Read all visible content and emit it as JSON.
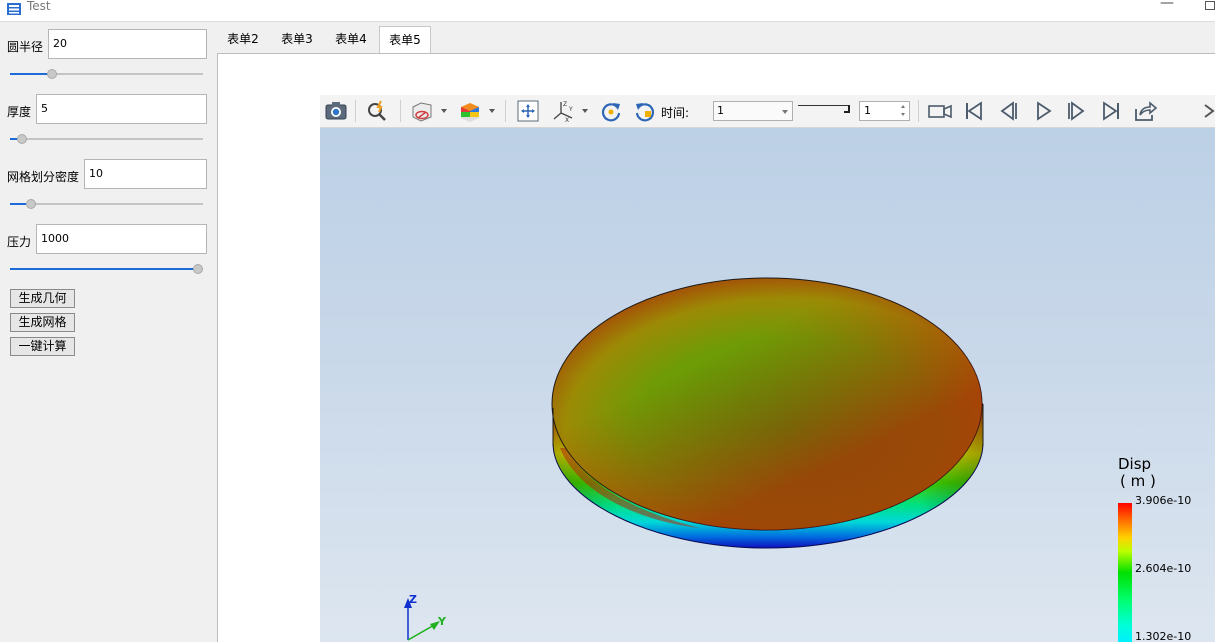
{
  "window": {
    "title": "Test",
    "minimize_glyph": "—"
  },
  "params": {
    "radius": {
      "label": "圆半径",
      "value": "20",
      "slider_fraction": 0.2
    },
    "thickness": {
      "label": "厚度",
      "value": "5",
      "slider_fraction": 0.04
    },
    "mesh_density": {
      "label": "网格划分密度",
      "value": "10",
      "slider_fraction": 0.09
    },
    "pressure": {
      "label": "压力",
      "value": "1000",
      "slider_fraction": 1.0
    }
  },
  "actions": {
    "gen_geometry": "生成几何",
    "gen_mesh": "生成网格",
    "compute": "一键计算"
  },
  "tabs": [
    {
      "label": "表单2",
      "active": false
    },
    {
      "label": "表单3",
      "active": false
    },
    {
      "label": "表单4",
      "active": false
    },
    {
      "label": "表单5",
      "active": true
    }
  ],
  "viewer": {
    "time_label": "时间:",
    "time_value": "1",
    "time_step": "1",
    "legend": {
      "title": "Disp",
      "unit": "( m )",
      "ticks": [
        "3.906e-10",
        "2.604e-10",
        "1.302e-10"
      ]
    },
    "axes": {
      "z": "Z",
      "y": "Y"
    }
  },
  "icons": {
    "toolbar": [
      "camera-icon",
      "probe-icon",
      "display-mode-icon",
      "color-map-icon",
      "fit-view-icon",
      "axis-view-icon",
      "rotate-cw-icon",
      "rotate-ccw-icon",
      "record-icon",
      "first-frame-icon",
      "previous-frame-icon",
      "play-icon",
      "next-frame-icon",
      "last-frame-icon",
      "export-icon"
    ]
  },
  "colors": {
    "accent": "#1c6bd6",
    "scene_top": "#bcd0e6",
    "scene_bottom": "#dde6f0"
  }
}
